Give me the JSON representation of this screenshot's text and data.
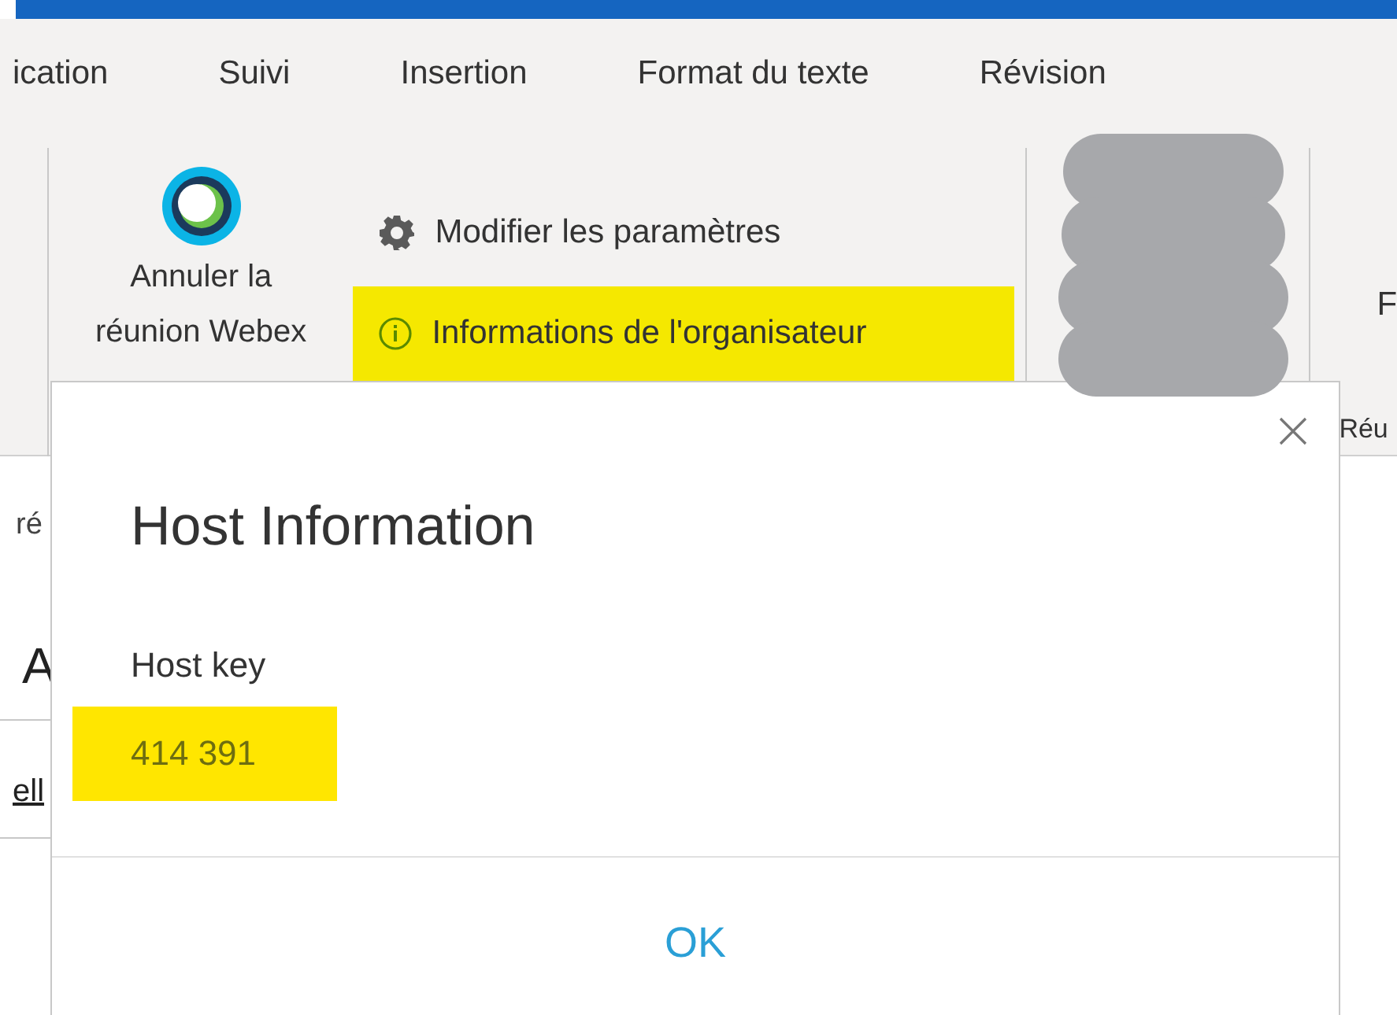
{
  "tabs": [
    {
      "label": "ication",
      "selected": false
    },
    {
      "label": "Suivi",
      "selected": false
    },
    {
      "label": "Insertion",
      "selected": false
    },
    {
      "label": "Format du texte",
      "selected": false
    },
    {
      "label": "Révision",
      "selected": false
    }
  ],
  "ribbon": {
    "cancel_button": [
      "Annuler la",
      "réunion Webex"
    ],
    "commands": [
      {
        "kind": "settings",
        "label": "Modifier les paramètres",
        "highlighted": false
      },
      {
        "kind": "info",
        "label": "Informations de l'organisateur",
        "highlighted": true
      }
    ],
    "cut_button_fragment": "F",
    "group_label_fragment": "Réu"
  },
  "page_fragments": [
    {
      "kind": "text",
      "text": "ré"
    },
    {
      "kind": "heading",
      "text": "A"
    },
    {
      "kind": "link",
      "text": "ell"
    }
  ],
  "dialog": {
    "title": "Host Information",
    "field_label": "Host key",
    "host_key": "414 391",
    "host_key_highlighted": true,
    "ok_button": "OK"
  }
}
